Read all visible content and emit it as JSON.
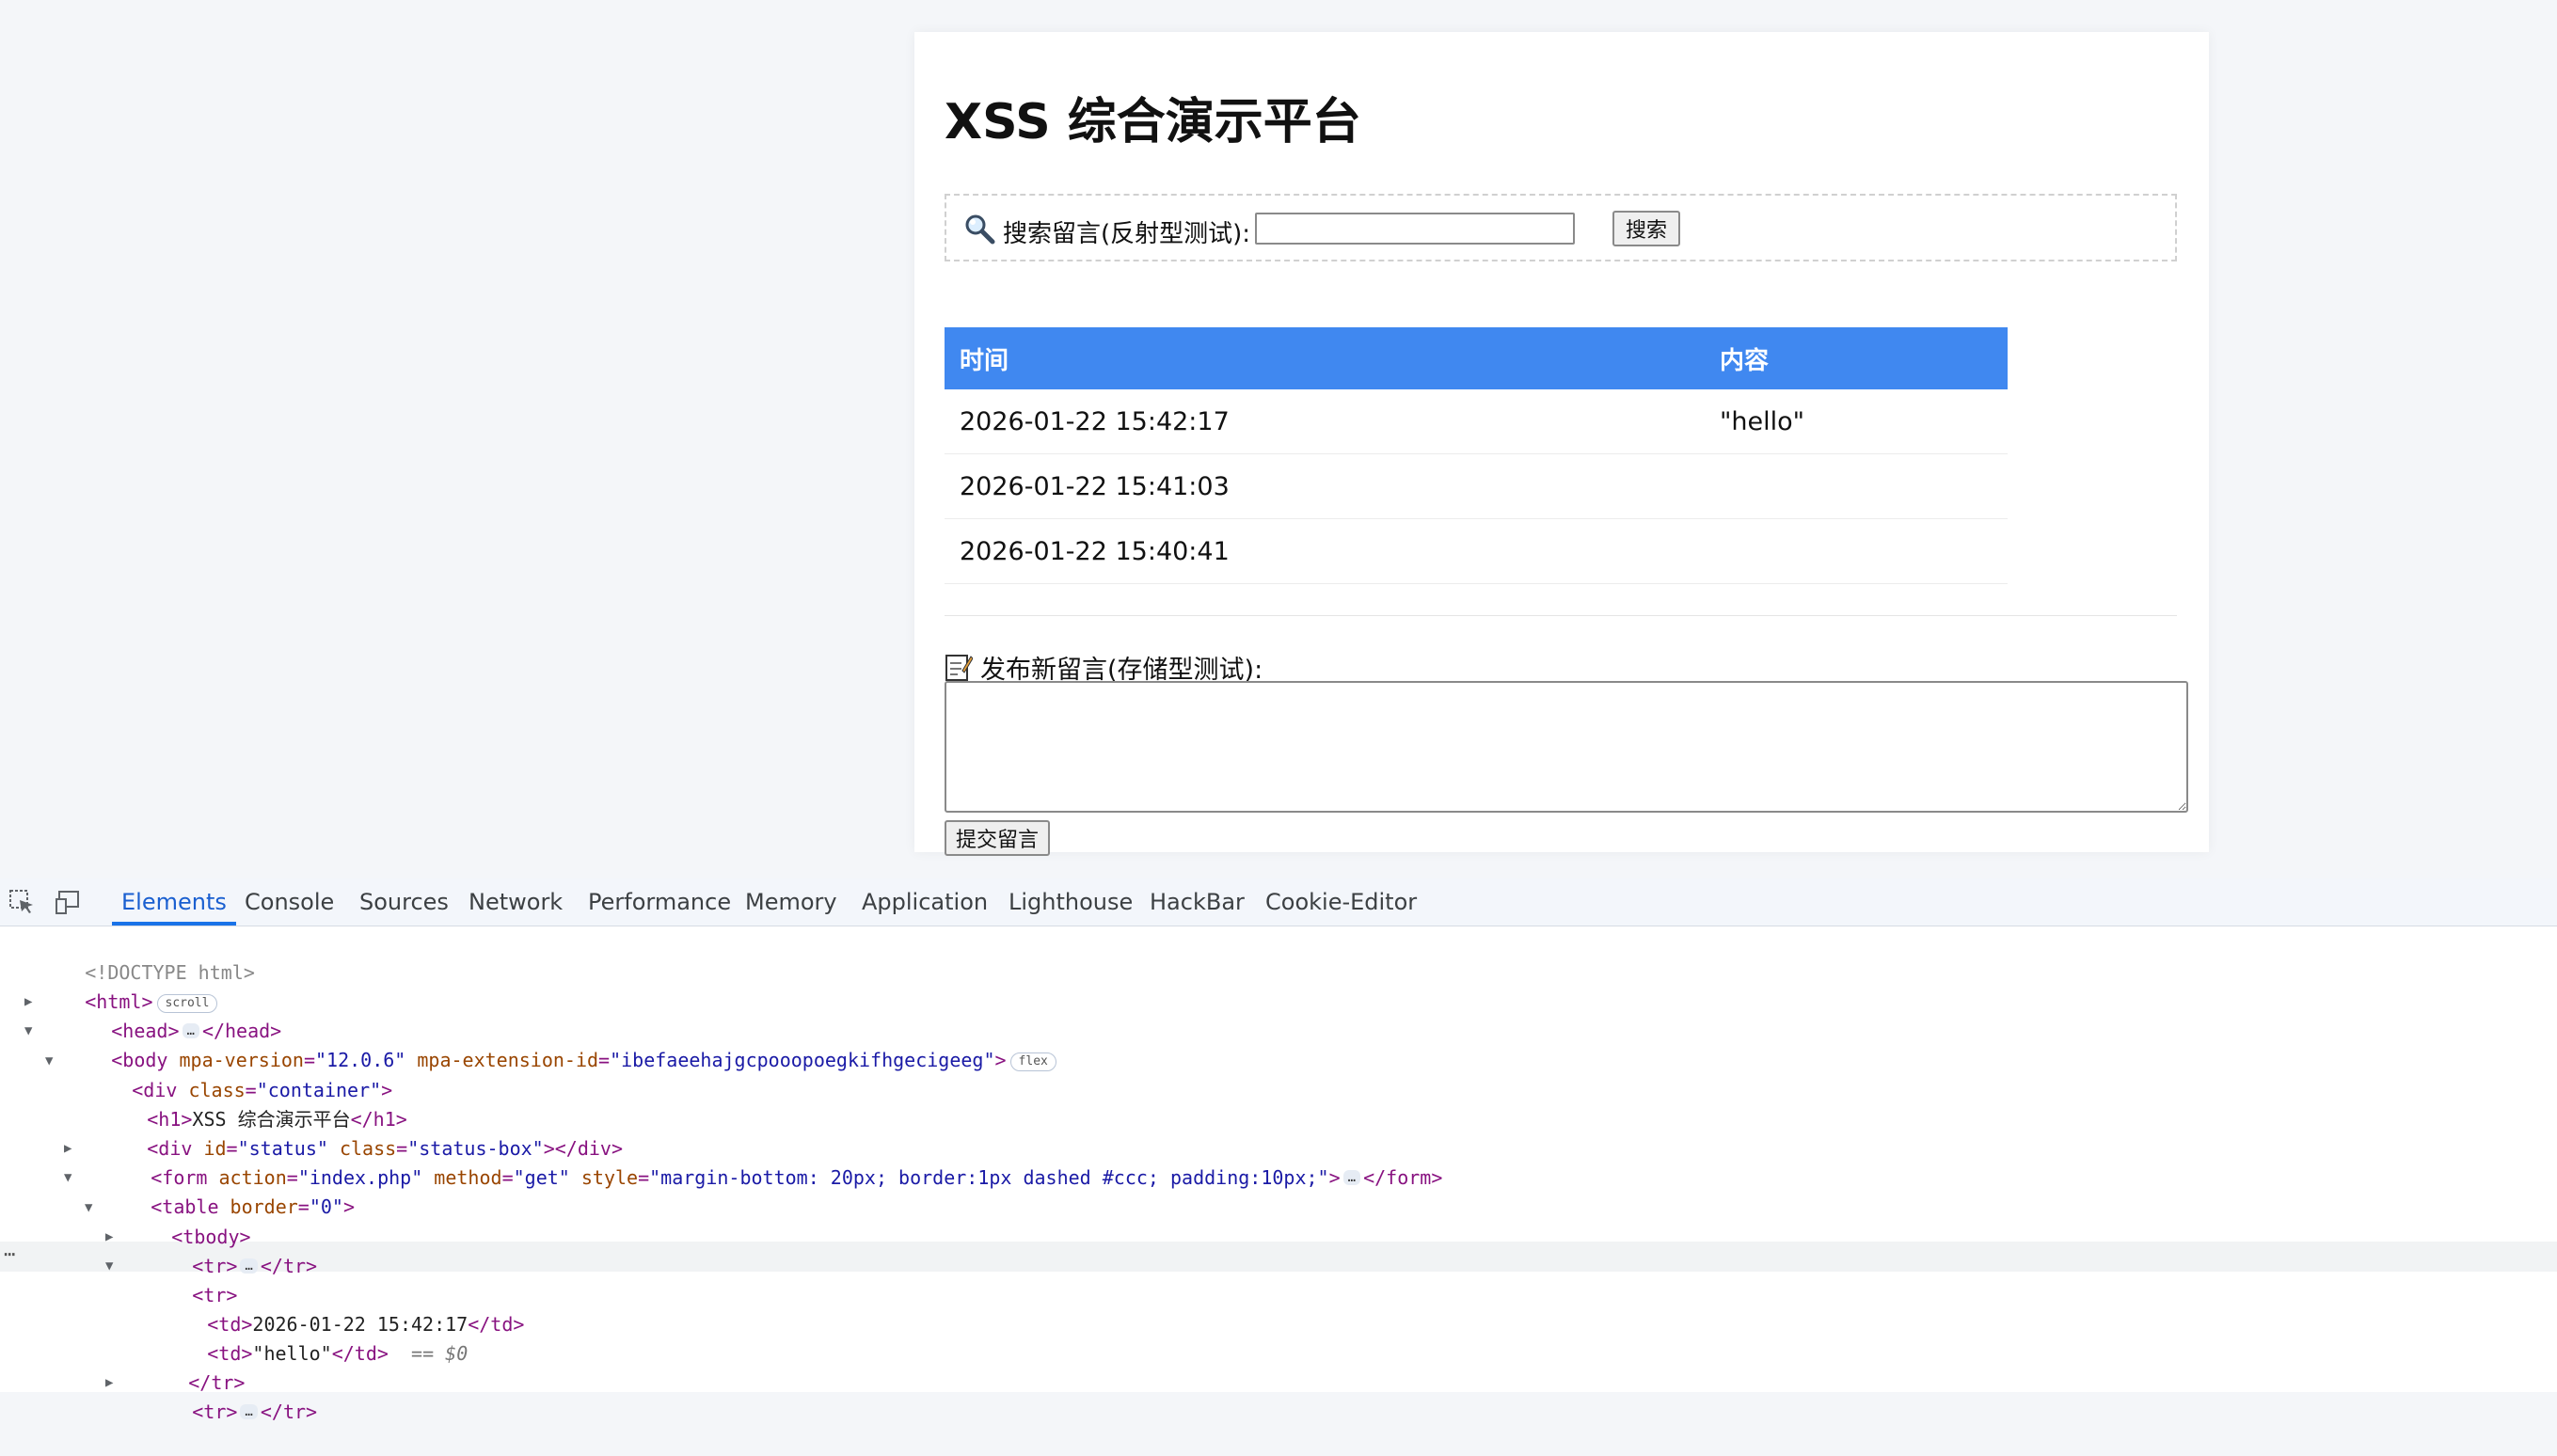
{
  "page": {
    "title": "XSS 综合演示平台",
    "search": {
      "label": "搜索留言(反射型测试):",
      "value": "",
      "button": "搜索"
    },
    "table": {
      "headers": [
        "时间",
        "内容"
      ],
      "rows": [
        {
          "time": "2026-01-22 15:42:17",
          "content": "\"hello\""
        },
        {
          "time": "2026-01-22 15:41:03",
          "content": ""
        },
        {
          "time": "2026-01-22 15:40:41",
          "content": ""
        }
      ]
    },
    "post": {
      "label": "发布新留言(存储型测试):",
      "value": "",
      "button": "提交留言"
    }
  },
  "devtools": {
    "tabs": [
      "Elements",
      "Console",
      "Sources",
      "Network",
      "Performance",
      "Memory",
      "Application",
      "Lighthouse",
      "HackBar",
      "Cookie-Editor"
    ],
    "active_tab": "Elements",
    "dom": {
      "doctype": "<!DOCTYPE html>",
      "html_open": "<html>",
      "html_badge": "scroll",
      "head_open": "<head>",
      "head_close": "</head>",
      "body_tag": "<body",
      "body_attr1_name": " mpa-version",
      "body_attr1_value": "\"12.0.6\"",
      "body_attr2_name": " mpa-extension-id",
      "body_attr2_value": "\"ibefaeehajgcpooopoegkifhgecigeeg\"",
      "body_badge": "flex",
      "div_tag": "<div",
      "div_attr_name": " class",
      "div_attr_value": "\"container\"",
      "h1_open": "<h1>",
      "h1_text": "XSS 综合演示平台",
      "h1_close": "</h1>",
      "status_tag": "<div",
      "status_id_name": " id",
      "status_id_value": "\"status\"",
      "status_class_name": " class",
      "status_class_value": "\"status-box\"",
      "status_close": "></div>",
      "form_tag": "<form",
      "form_action_name": " action",
      "form_action_value": "\"index.php\"",
      "form_method_name": " method",
      "form_method_value": "\"get\"",
      "form_style_name": " style",
      "form_style_value": "\"margin-bottom: 20px; border:1px dashed #ccc; padding:10px;\"",
      "form_close": "</form>",
      "table_tag": "<table",
      "table_border_name": " border",
      "table_border_value": "\"0\"",
      "tbody_open": "<tbody>",
      "tr_open": "<tr>",
      "tr_close": "</tr>",
      "td_open": "<td>",
      "td_close": "</td>",
      "td1_text": "2026-01-22 15:42:17",
      "td2_text": "\"hello\"",
      "sel_marker": "== $0"
    }
  }
}
